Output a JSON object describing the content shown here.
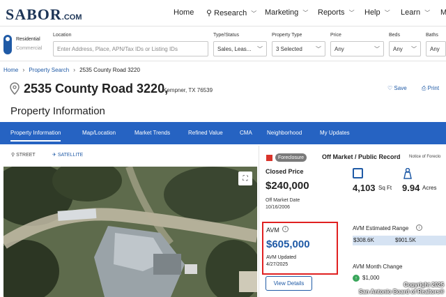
{
  "logo": {
    "text": "SABOR",
    "suffix": ".COM"
  },
  "nav": {
    "home": "Home",
    "research": "Research",
    "marketing": "Marketing",
    "reports": "Reports",
    "help": "Help",
    "learn": "Learn",
    "more": "M"
  },
  "filters": {
    "toggle_residential": "Residential",
    "toggle_commercial": "Commercial",
    "location_label": "Location",
    "location_placeholder": "Enter Address, Place, APN/Tax IDs or Listing IDs",
    "status_label": "Type/Status",
    "status_value": "Sales, Leas...",
    "ptype_label": "Property Type",
    "ptype_value": "3 Selected",
    "price_label": "Price",
    "price_value": "Any",
    "beds_label": "Beds",
    "beds_value": "Any",
    "baths_label": "Baths",
    "baths_value": "Any"
  },
  "breadcrumb": {
    "home": "Home",
    "search": "Property Search",
    "current": "2535 County Road 3220"
  },
  "property": {
    "address": "2535 County Road 3220,",
    "city": "Kempner, TX 76539",
    "save": "Save",
    "print": "Print"
  },
  "page_title": "Property Information",
  "tabs": [
    "Property Information",
    "Map/Location",
    "Market Trends",
    "Refined Value",
    "CMA",
    "Neighborhood",
    "My Updates"
  ],
  "views": {
    "street": "STREET",
    "satellite": "SATELLITE"
  },
  "listing": {
    "badge": "Foreclosure",
    "status": "Off Market / Public Record",
    "notice": "Notice of Foreclo",
    "closed_label": "Closed Price",
    "closed_price": "$240,000",
    "off_market_label": "Off Market Date",
    "off_market_date": "10/16/2006",
    "sqft_value": "4,103",
    "sqft_unit": "Sq Ft",
    "acres_value": "9.94",
    "acres_unit": "Acres"
  },
  "avm": {
    "label": "AVM",
    "value": "$605,000",
    "updated_label": "AVM Updated",
    "updated_date": "4/27/2025",
    "view_details": "View Details",
    "range_label": "AVM Estimated Range",
    "range_low": "$308.6K",
    "range_high": "$901.5K",
    "month_change_label": "AVM Month Change",
    "month_change_value": "$1,000"
  },
  "copyright": {
    "line1": "Copyright 2025",
    "line2": "San Antonio Board of Realtors®"
  },
  "colors": {
    "brand_blue": "#2663c2",
    "link_blue": "#1f5aa6",
    "alert_red": "#e02020",
    "up_green": "#3aa65b"
  }
}
